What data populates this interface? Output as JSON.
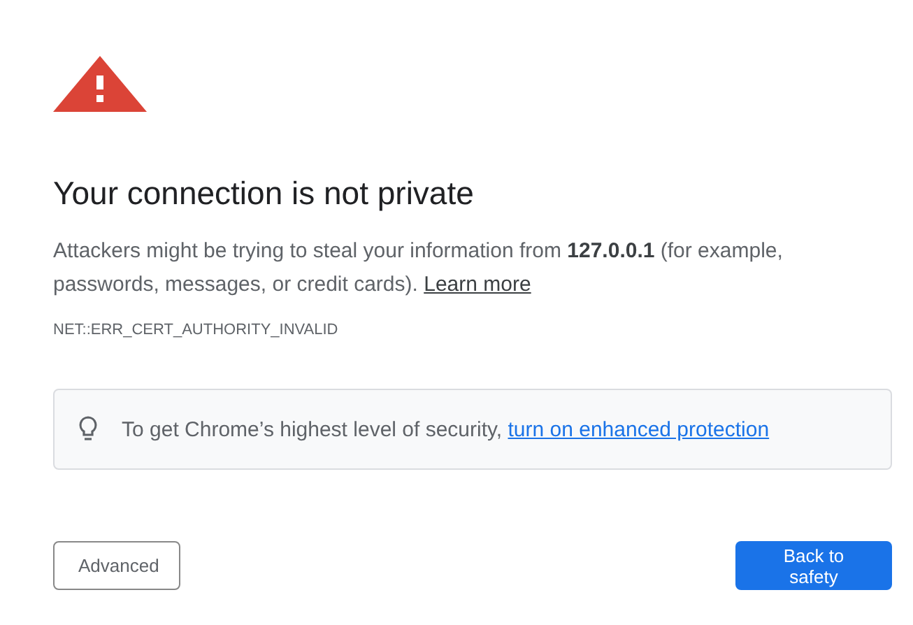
{
  "heading": "Your connection is not private",
  "message": {
    "text": "Attackers might be trying to steal your information from **127.0.0.1** (for example, passwords, messages, or credit cards).",
    "link": "Learn more"
  },
  "error_code": "NET::ERR_CERT_AUTHORITY_INVALID",
  "tip": {
    "text": "To get Chrome’s highest level of security,",
    "link": "turn on enhanced protection"
  },
  "buttons": [
    {
      "label": "Advanced",
      "kind": "secondary"
    },
    {
      "label": "Back to safety",
      "kind": "primary"
    }
  ]
}
